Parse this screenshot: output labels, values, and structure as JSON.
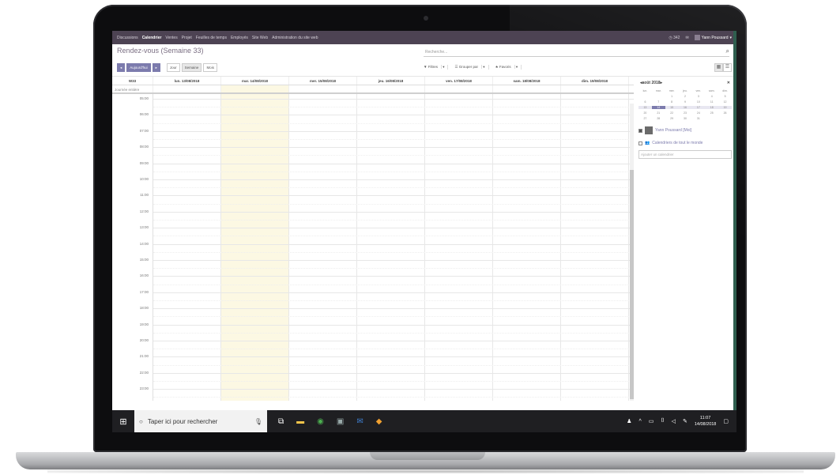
{
  "topbar": {
    "menu": [
      "Discussions",
      "Calendrier",
      "Ventes",
      "Projet",
      "Feuilles de temps",
      "Employés",
      "Site Web",
      "Administration du site web"
    ],
    "active": "Calendrier",
    "chat": "342",
    "user": "Yann Poussard"
  },
  "control": {
    "title": "Rendez-vous (Semaine 33)",
    "search_placeholder": "Recherche...",
    "today_label": "Aujourd'hui",
    "views": [
      "Jour",
      "Semaine",
      "Mois"
    ],
    "filters": [
      "Filtres",
      "Grouper par",
      "Favoris"
    ]
  },
  "calendar": {
    "week": "W33",
    "days": [
      "lun. 13/08/2018",
      "mar. 14/08/2018",
      "mer. 15/08/2018",
      "jeu. 16/08/2018",
      "ven. 17/08/2018",
      "sam. 18/08/2018",
      "dim. 19/08/2018"
    ],
    "allday_label": "Journée entière",
    "hours": [
      "05:00",
      "06:00",
      "07:00",
      "08:00",
      "09:00",
      "10:00",
      "11:00",
      "12:00",
      "13:00",
      "14:00",
      "15:00",
      "16:00",
      "17:00",
      "18:00",
      "19:00",
      "20:00",
      "21:00",
      "22:00",
      "23:00"
    ]
  },
  "sidebar": {
    "month": "août 2018",
    "weekdays": [
      "lun.",
      "mar.",
      "mer.",
      "jeu.",
      "ven.",
      "sam.",
      "dim."
    ],
    "calendars": [
      {
        "label": "Yann Poussard [Moi]",
        "checked": true
      },
      {
        "label": "Calendriers de tout le monde",
        "checked": false
      }
    ],
    "add_placeholder": "Ajouter un calendrier"
  },
  "taskbar": {
    "search": "Taper ici pour rechercher",
    "time": "11:07",
    "date": "14/08/2018"
  }
}
